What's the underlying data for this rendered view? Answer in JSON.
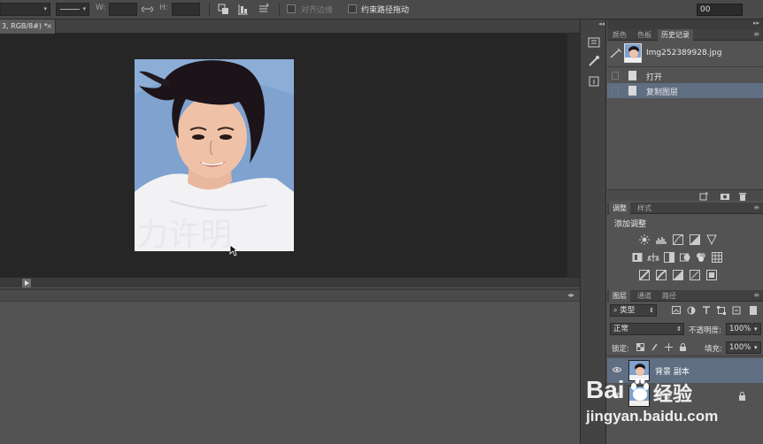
{
  "options_bar": {
    "w_label": "W:",
    "h_label": "H:",
    "align_edges_label": "对齐边缘",
    "constrain_path_label": "约束路径拖动",
    "right_value": "00"
  },
  "document": {
    "tab_label": "3, RGB/8#) *",
    "tab_close": "×"
  },
  "panels": {
    "history": {
      "tabs": [
        "颜色",
        "色板",
        "历史记录"
      ],
      "snapshot_name": "Img252389928.jpg",
      "items": [
        {
          "label": "打开",
          "selected": false
        },
        {
          "label": "复制图层",
          "selected": true
        }
      ]
    },
    "adjustments": {
      "tabs": [
        "调整",
        "样式"
      ],
      "title": "添加调整"
    },
    "layers": {
      "tabs": [
        "图层",
        "通道",
        "路径"
      ],
      "filter_kind": "类型",
      "blend_mode": "正常",
      "opacity_label": "不透明度:",
      "opacity_value": "100%",
      "lock_label": "锁定:",
      "fill_label": "填充:",
      "fill_value": "100%",
      "items": [
        {
          "name": "背景 副本",
          "selected": true
        },
        {
          "name": "背景",
          "selected": false
        }
      ]
    }
  },
  "watermark": {
    "brand": "Bai",
    "brand2": "经验",
    "url": "jingyan.baidu.com"
  },
  "colors": {
    "selection": "#5f6e82",
    "panel_bg": "#535353",
    "canvas_bg": "#262626",
    "photo_bg": "#7fa2cf"
  }
}
